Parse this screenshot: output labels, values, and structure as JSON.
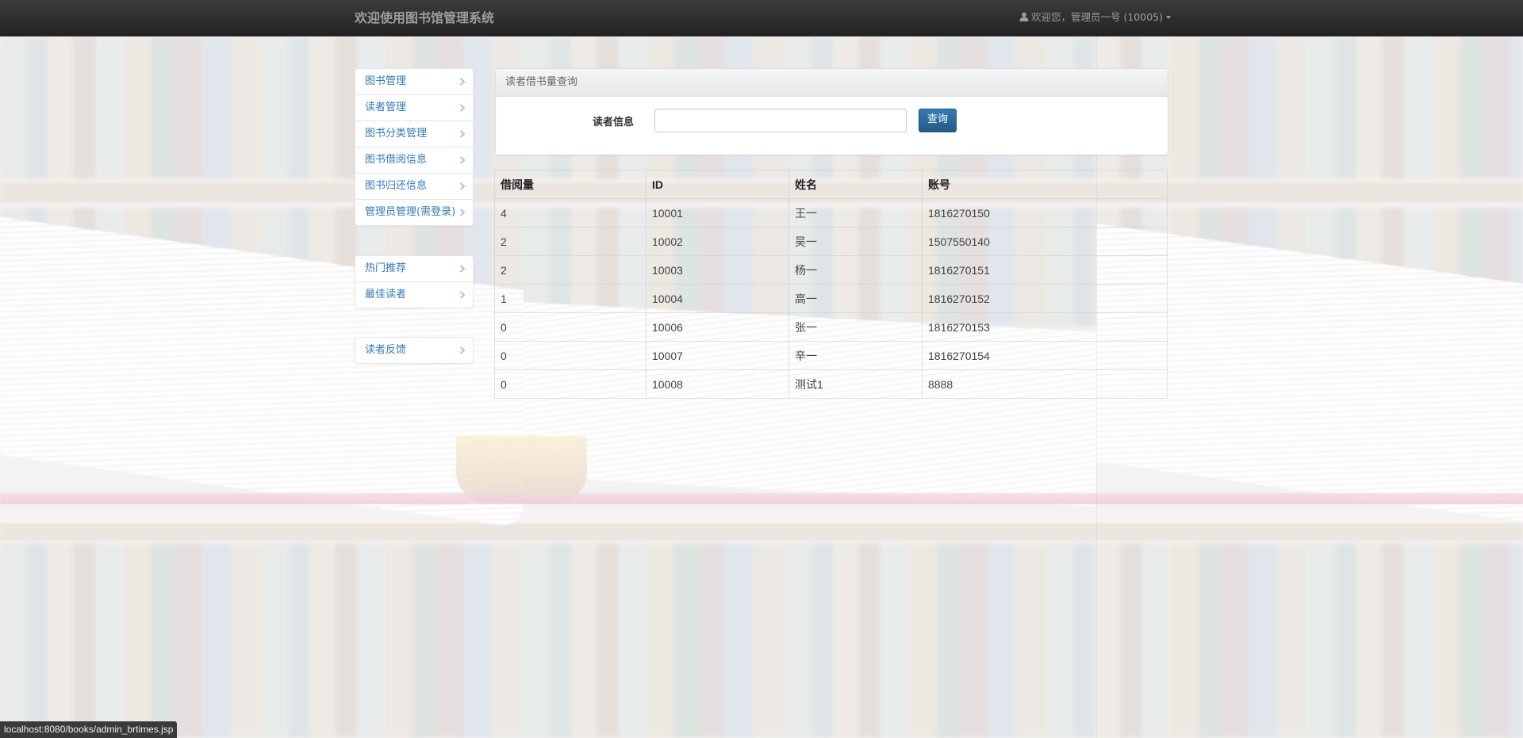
{
  "navbar": {
    "brand": "欢迎使用图书馆管理系统",
    "user_label": "欢迎您，管理员一号 (10005)"
  },
  "sidebar": {
    "group1": [
      {
        "label": "图书管理"
      },
      {
        "label": "读者管理"
      },
      {
        "label": "图书分类管理"
      },
      {
        "label": "图书借阅信息"
      },
      {
        "label": "图书归还信息"
      },
      {
        "label": "管理员管理(需登录)"
      }
    ],
    "group2": [
      {
        "label": "热门推荐"
      },
      {
        "label": "最佳读者"
      }
    ],
    "group3": [
      {
        "label": "读者反馈"
      }
    ]
  },
  "query_panel": {
    "heading": "读者借书量查询",
    "label": "读者信息",
    "input_value": "",
    "input_placeholder": "",
    "button_label": "查询"
  },
  "table": {
    "headers": [
      "借阅量",
      "ID",
      "姓名",
      "账号"
    ],
    "rows": [
      [
        "4",
        "10001",
        "王一",
        "1816270150"
      ],
      [
        "2",
        "10002",
        "吴一",
        "1507550140"
      ],
      [
        "2",
        "10003",
        "杨一",
        "1816270151"
      ],
      [
        "1",
        "10004",
        "高一",
        "1816270152"
      ],
      [
        "0",
        "10006",
        "张一",
        "1816270153"
      ],
      [
        "0",
        "10007",
        "辛一",
        "1816270154"
      ],
      [
        "0",
        "10008",
        "测试1",
        "8888"
      ]
    ]
  },
  "status_bar": {
    "url": "localhost:8080/books/admin_brtimes.jsp"
  },
  "icons": {
    "user": "user-icon",
    "caret": "caret-down-icon",
    "chevron": "chevron-right-icon"
  },
  "colors": {
    "navbar": "#222222",
    "link": "#337ab7",
    "primary_button": "#337ab7"
  }
}
